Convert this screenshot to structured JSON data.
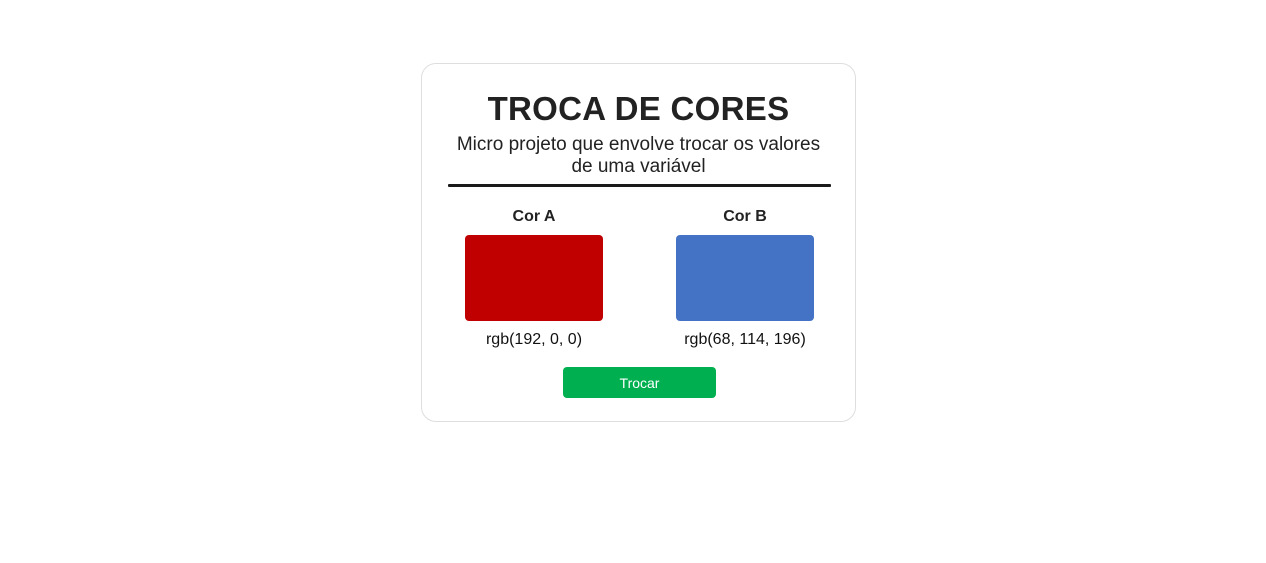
{
  "header": {
    "title": "TROCA DE CORES",
    "subtitle": "Micro projeto que envolve trocar os valores de uma variável"
  },
  "colors": [
    {
      "label": "Cor A",
      "value": "rgb(192, 0, 0)",
      "hex": "#c00000"
    },
    {
      "label": "Cor B",
      "value": "rgb(68, 114, 196)",
      "hex": "#4472c4"
    }
  ],
  "actions": {
    "swap_label": "Trocar",
    "swap_color": "#00b050"
  }
}
